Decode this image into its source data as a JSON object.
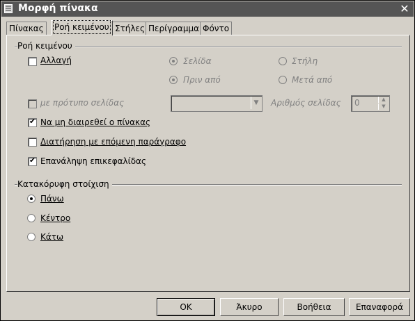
{
  "window": {
    "title": "Μορφή πίνακα"
  },
  "tabs": [
    {
      "label": "Πίνακας"
    },
    {
      "label": "Ροή κειμένου"
    },
    {
      "label": "Στήλες"
    },
    {
      "label": "Περίγραμμα"
    },
    {
      "label": "Φόντο"
    }
  ],
  "active_tab": 1,
  "text_flow": {
    "group_title": "Ροή κειμένου",
    "break_label": "Αλλαγή",
    "break_checked": false,
    "page_label": "Σελίδα",
    "column_label": "Στήλη",
    "before_label": "Πριν από",
    "after_label": "Μετά από",
    "page_style_label": "με πρότυπο σελίδας",
    "page_style_value": "",
    "page_number_label": "Αριθμός σελίδας",
    "page_number_value": "0",
    "no_split_label": "Να μη διαιρεθεί ο πίνακας",
    "no_split_checked": true,
    "keep_next_label": "Διατήρηση με επόμενη παράγραφο",
    "keep_next_checked": false,
    "repeat_heading_label": "Επανάληψη επικεφαλίδας",
    "repeat_heading_checked": true
  },
  "vertical_alignment": {
    "group_title": "Κατακόρυφη στοίχιση",
    "top_label": "Πάνω",
    "center_label": "Κέντρο",
    "bottom_label": "Κάτω",
    "selected": "top"
  },
  "buttons": {
    "ok": "OK",
    "cancel": "Άκυρο",
    "help": "Βοήθεια",
    "reset": "Επαναφορά"
  }
}
